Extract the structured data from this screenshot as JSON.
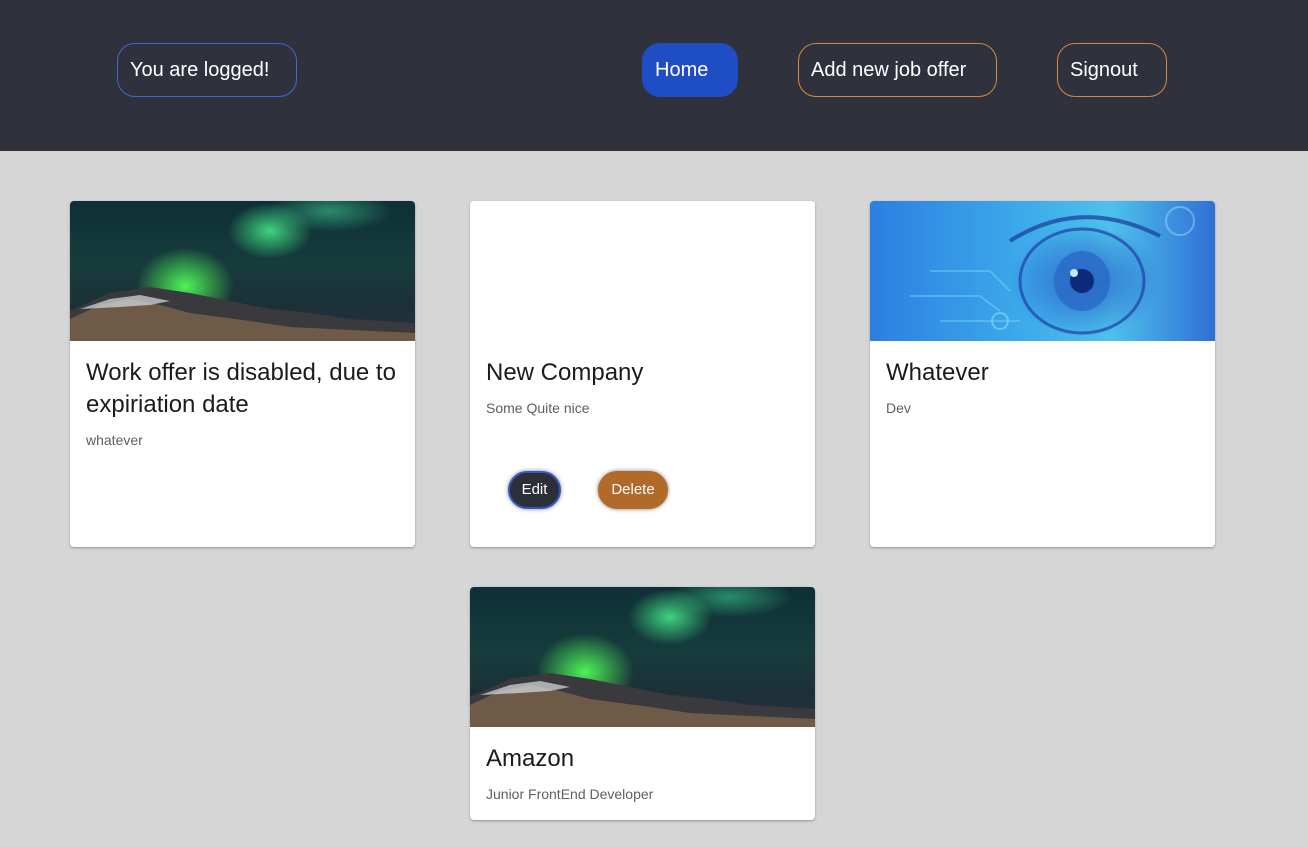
{
  "header": {
    "status_label": "You are logged!",
    "nav": {
      "home_label": "Home",
      "add_offer_label": "Add new job offer",
      "signout_label": "Signout"
    }
  },
  "colors": {
    "header_bg": "#2f323c",
    "page_bg": "#d6d6d6",
    "home_active": "#1f4dc4",
    "outline_blue": "#3f67d6",
    "outline_orange": "#d2883e",
    "delete_bg": "#b16a2a"
  },
  "cards": [
    {
      "image": "aurora-landscape",
      "title": "Work offer is disabled, due to expiriation date",
      "subtitle": "whatever"
    },
    {
      "image": "none",
      "title": "New Company",
      "subtitle": "Some Quite nice",
      "actions": {
        "edit_label": "Edit",
        "delete_label": "Delete"
      }
    },
    {
      "image": "digital-eye",
      "title": "Whatever",
      "subtitle": "Dev"
    },
    {
      "image": "aurora-landscape",
      "title": "Amazon",
      "subtitle": "Junior FrontEnd Developer"
    }
  ]
}
